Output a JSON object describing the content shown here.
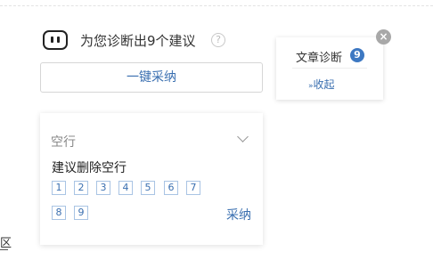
{
  "summary": {
    "text": "为您诊断出9个建议",
    "help_glyph": "?"
  },
  "adopt_all": {
    "label": "一键采纳"
  },
  "diagnosis_panel": {
    "title": "文章诊断",
    "count": "9",
    "collapse_chevron": "»",
    "collapse_label": "收起"
  },
  "close_glyph": "×",
  "suggestion": {
    "title": "空行",
    "description": "建议删除空行",
    "line_numbers": [
      "1",
      "2",
      "3",
      "4",
      "5",
      "6",
      "7",
      "8",
      "9"
    ],
    "adopt_label": "采纳"
  },
  "edge_text": "区",
  "colors": {
    "link_blue": "#3a6fb0",
    "badge_blue": "#3d78c2",
    "close_gray": "#a8a8a8"
  }
}
